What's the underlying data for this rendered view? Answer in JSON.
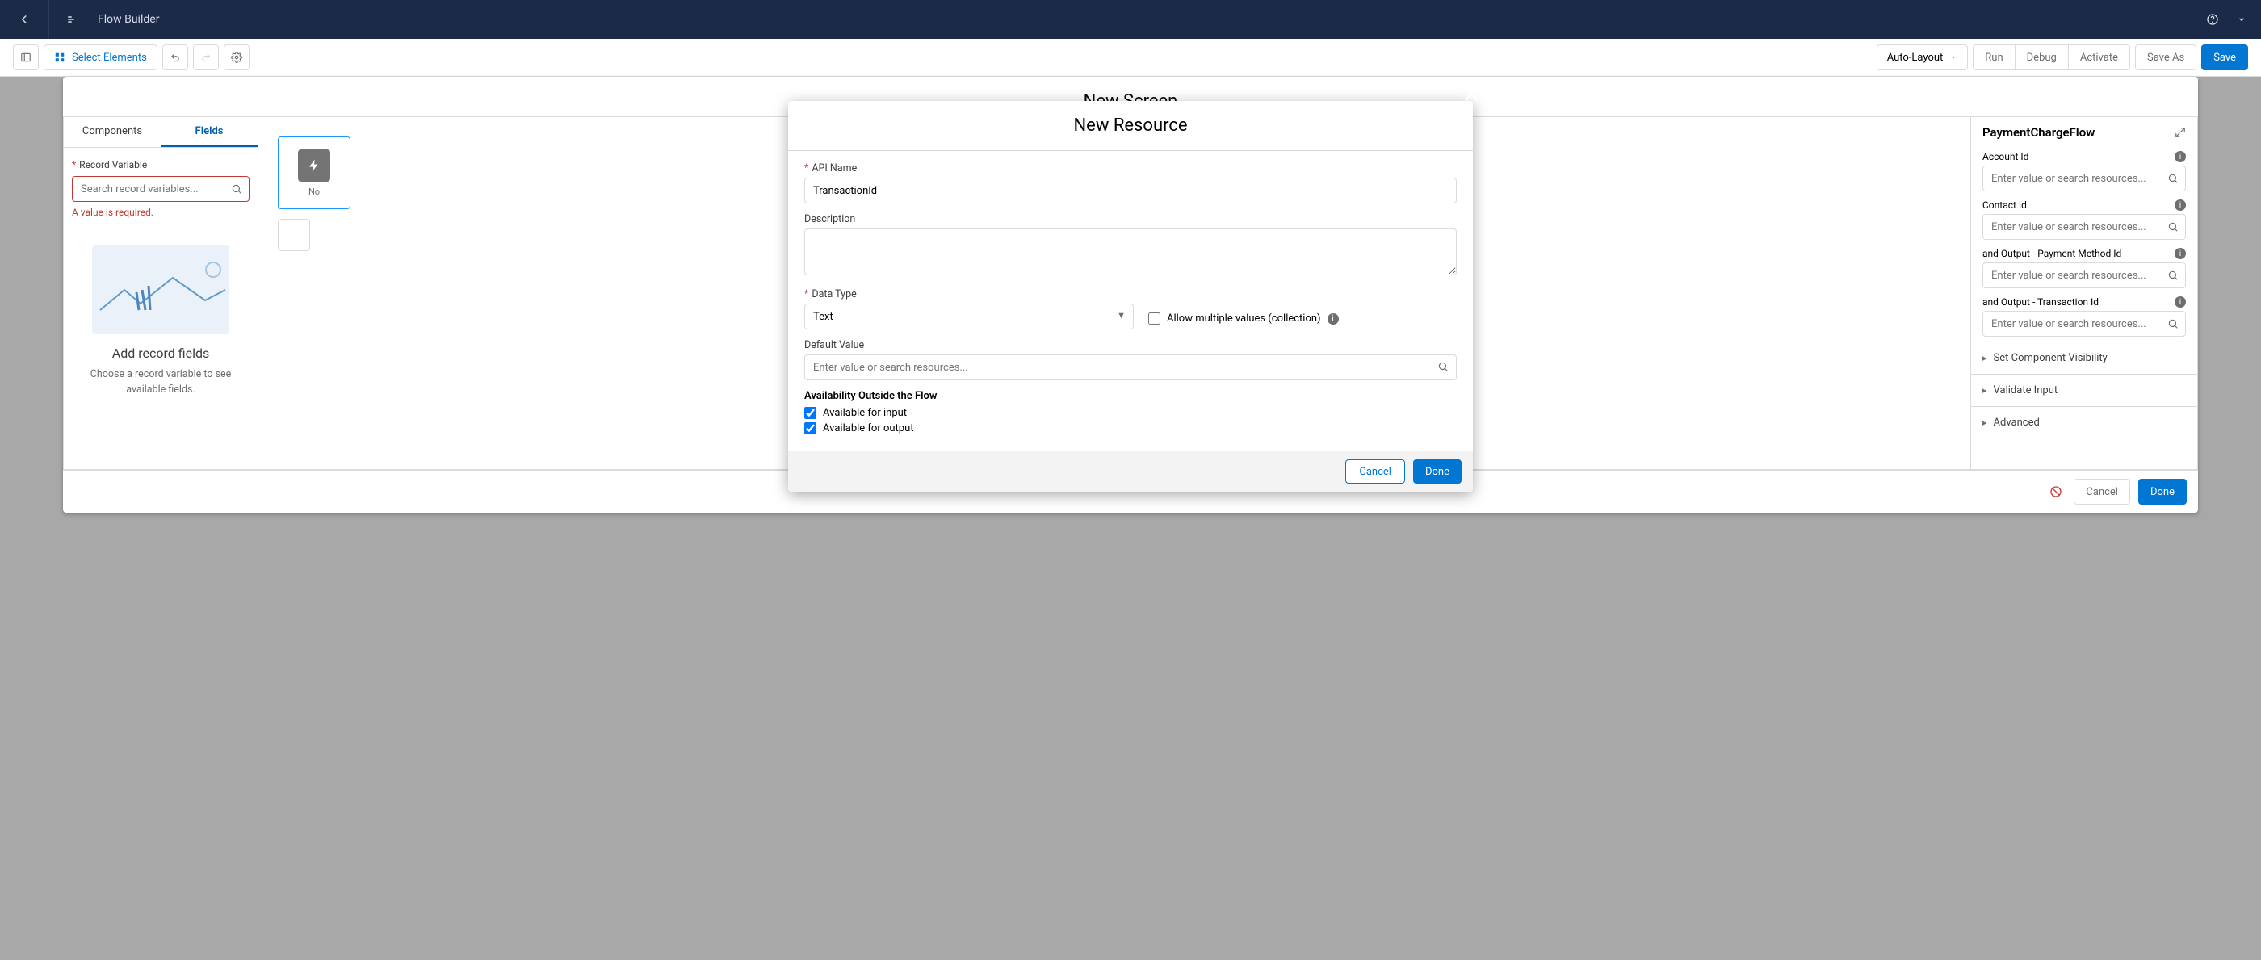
{
  "topbar": {
    "title": "Flow Builder"
  },
  "toolbar": {
    "select_elements": "Select Elements",
    "layout": "Auto-Layout",
    "run": "Run",
    "debug": "Debug",
    "activate": "Activate",
    "save_as": "Save As",
    "save": "Save"
  },
  "outerModal": {
    "title": "New Screen",
    "leftPanel": {
      "tabs": {
        "components": "Components",
        "fields": "Fields"
      },
      "recordVarLabel": "Record Variable",
      "searchPlaceholder": "Search record variables...",
      "error": "A value is required.",
      "emptyTitle": "Add record fields",
      "emptySub": "Choose a record variable to see available fields."
    },
    "centerPanel": {
      "blockLabel": "No"
    },
    "rightPanel": {
      "componentName": "PaymentChargeFlow",
      "fields": [
        {
          "label": "Account Id",
          "placeholder": "Enter value or search resources..."
        },
        {
          "label": "Contact Id",
          "placeholder": "Enter value or search resources..."
        },
        {
          "label": "and Output - Payment Method Id",
          "placeholder": "Enter value or search resources..."
        },
        {
          "label": "and Output - Transaction Id",
          "placeholder": "Enter value or search resources..."
        }
      ],
      "accordion": {
        "visibility": "Set Component Visibility",
        "validate": "Validate Input",
        "advanced": "Advanced"
      }
    },
    "footer": {
      "cancel": "Cancel",
      "done": "Done"
    }
  },
  "innerModal": {
    "title": "New Resource",
    "apiName": {
      "label": "API Name",
      "value": "TransactionId"
    },
    "description": {
      "label": "Description"
    },
    "dataType": {
      "label": "Data Type",
      "value": "Text"
    },
    "allowMultiple": {
      "label": "Allow multiple values (collection)"
    },
    "defaultValue": {
      "label": "Default Value",
      "placeholder": "Enter value or search resources..."
    },
    "availability": {
      "heading": "Availability Outside the Flow",
      "input": "Available for input",
      "output": "Available for output"
    },
    "footer": {
      "cancel": "Cancel",
      "done": "Done"
    }
  }
}
